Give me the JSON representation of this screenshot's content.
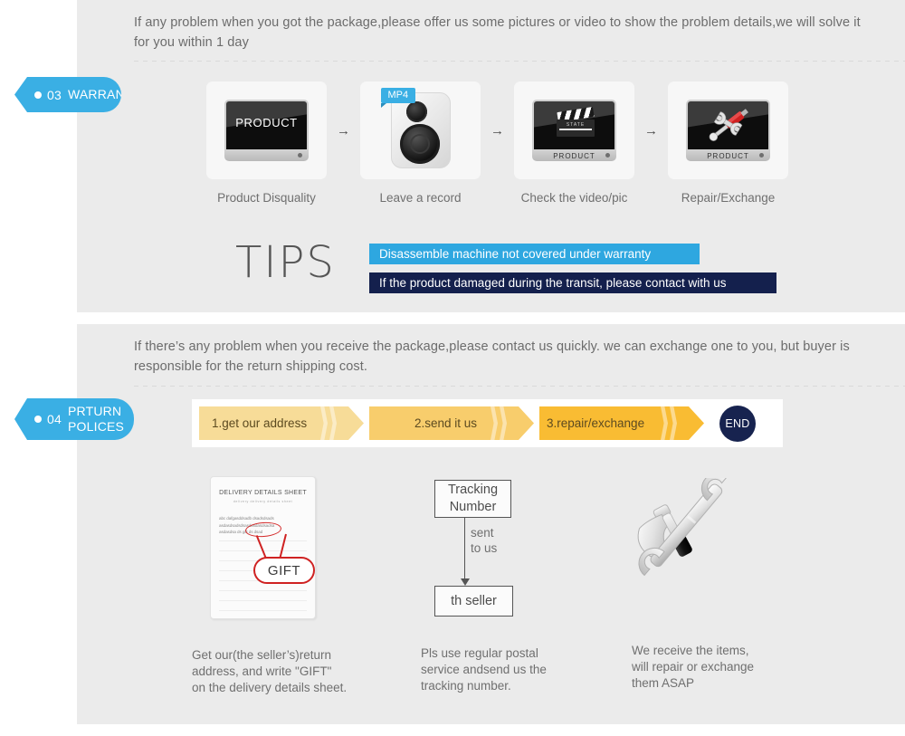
{
  "warranty_section": {
    "badge": {
      "num": "03",
      "label": "WARRANTY"
    },
    "intro": "If any problem when you got the package,please offer us some pictures or video to show the problem details,we will solve it for you within 1 day",
    "steps": [
      {
        "caption": "Product Disquality",
        "icon": "monitor-product-icon",
        "screen_text": "PRODUCT",
        "base_text": ""
      },
      {
        "caption": "Leave a record",
        "icon": "camera-mp4-icon",
        "tag": "MP4"
      },
      {
        "caption": "Check the video/pic",
        "icon": "monitor-clapper-icon",
        "base_text": "PRODUCT",
        "clapper_text": "STATE"
      },
      {
        "caption": "Repair/Exchange",
        "icon": "monitor-tools-icon",
        "base_text": "PRODUCT"
      }
    ],
    "arrow_glyph": "→",
    "tips": {
      "title": "TIPS",
      "bar1": "Disassemble machine not covered under warranty",
      "bar2": "If the product damaged during the transit, please contact with us",
      "bar1_color": "#2ea7e0",
      "bar2_color": "#14204d"
    }
  },
  "returns_section": {
    "badge": {
      "num": "04",
      "label": "PRTURN\nPOLICES"
    },
    "intro": "If  there’s any problem when you receive the package,please contact us quickly. we can exchange one to you, but buyer is responsible for the return shipping cost.",
    "flow": {
      "steps": [
        {
          "label": "1.get our address",
          "color": "#f7dc98"
        },
        {
          "label": "2.send it us",
          "color": "#f8cd6c"
        },
        {
          "label": "3.repair/exchange",
          "color": "#f9bc33"
        }
      ],
      "end_label": "END",
      "end_color": "#17234f"
    },
    "columns": [
      {
        "caption": "Get our(the seller’s)return\naddress, and write \"GIFT\"\non the delivery details sheet.",
        "sheet": {
          "title": "DELIVERY DETAILS SHEET",
          "subtitle": "delivery            delivery details sheet",
          "body_lines": [
            "abc dafgasddsadb dsadsdsads",
            "asdasdsadsdsasdasdasdsadsa",
            "asdasdsa ds gift ds dsad"
          ],
          "callout": "GIFT"
        }
      },
      {
        "caption": "Pls use regular postal\nservice andsend us the\n tracking number.",
        "flow": {
          "top_box": "Tracking\nNumber",
          "arrow_label": "sent\nto us",
          "bottom_box": "th seller"
        }
      },
      {
        "caption": "We receive the items,\nwill repair or exchange\n them ASAP",
        "icon": "hammer-wrench-icon"
      }
    ]
  },
  "theme": {
    "panel_bg": "#ebebeb",
    "page_bg": "#ffffff",
    "accent_blue": "#3aafe4",
    "text_gray": "#6f6f6f"
  }
}
